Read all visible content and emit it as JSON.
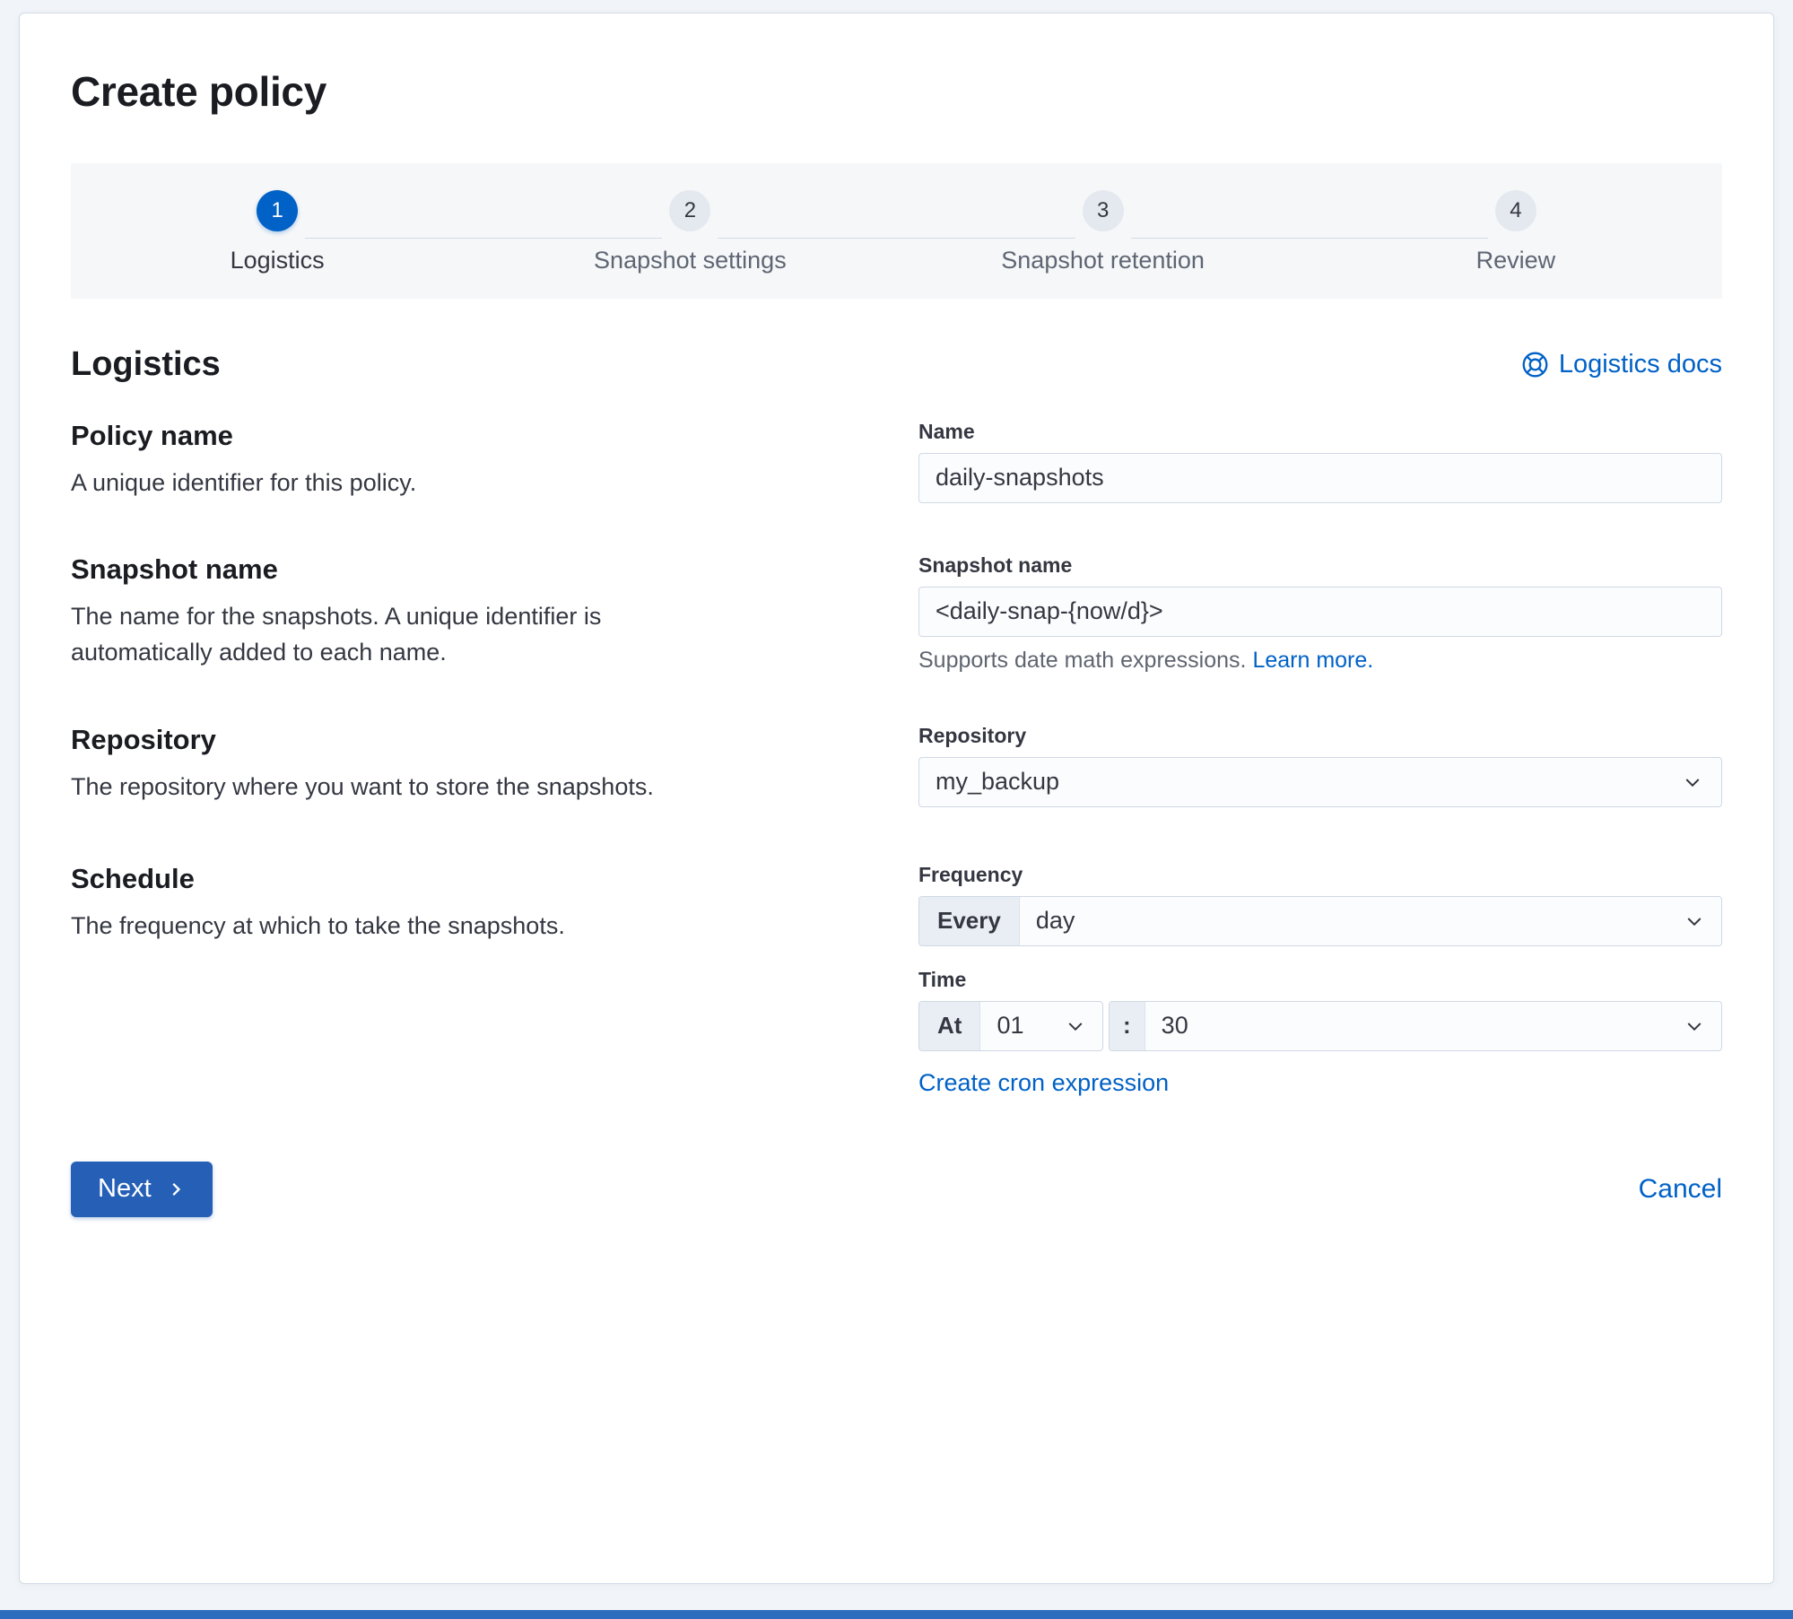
{
  "page": {
    "title": "Create policy"
  },
  "steps": {
    "items": [
      {
        "number": "1",
        "label": "Logistics",
        "status": "active"
      },
      {
        "number": "2",
        "label": "Snapshot settings",
        "status": "incomplete"
      },
      {
        "number": "3",
        "label": "Snapshot retention",
        "status": "incomplete"
      },
      {
        "number": "4",
        "label": "Review",
        "status": "incomplete"
      }
    ]
  },
  "section": {
    "title": "Logistics",
    "docs_link": "Logistics docs"
  },
  "form": {
    "policy_name": {
      "heading": "Policy name",
      "description": "A unique identifier for this policy.",
      "label": "Name",
      "value": "daily-snapshots"
    },
    "snapshot_name": {
      "heading": "Snapshot name",
      "description": "The name for the snapshots. A unique identifier is automatically added to each name.",
      "label": "Snapshot name",
      "value": "<daily-snap-{now/d}>",
      "help_text": "Supports date math expressions.",
      "help_link": "Learn more."
    },
    "repository": {
      "heading": "Repository",
      "description": "The repository where you want to store the snapshots.",
      "label": "Repository",
      "value": "my_backup"
    },
    "schedule": {
      "heading": "Schedule",
      "description": "The frequency at which to take the snapshots.",
      "frequency_label": "Frequency",
      "frequency_prepend": "Every",
      "frequency_value": "day",
      "time_label": "Time",
      "time_prepend": "At",
      "hour_value": "01",
      "time_separator": ":",
      "minute_value": "30",
      "cron_link": "Create cron expression"
    }
  },
  "footer": {
    "next_label": "Next",
    "cancel_label": "Cancel"
  },
  "colors": {
    "link": "#0061c6",
    "step_active": "#0061c6",
    "button_primary": "#2660b6",
    "bottom_bar": "#2e6dbe"
  }
}
